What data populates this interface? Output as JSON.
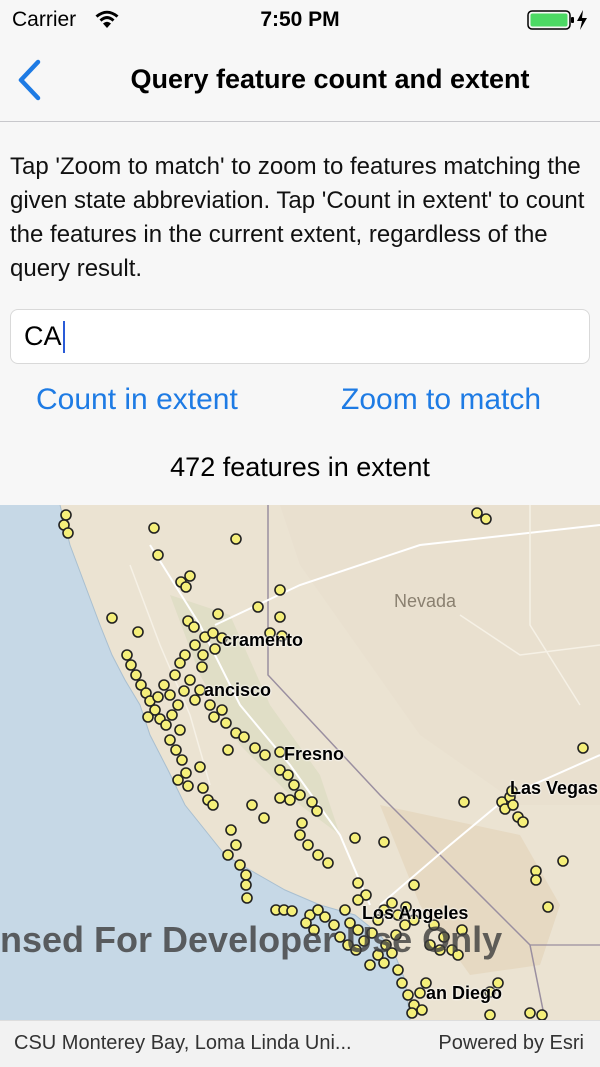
{
  "status": {
    "carrier": "Carrier",
    "time": "7:50 PM"
  },
  "nav": {
    "title": "Query feature count and extent"
  },
  "instructions": "Tap 'Zoom to match' to zoom to features matching the given state abbreviation. Tap 'Count in extent' to count the features in the current extent, regardless of the query result.",
  "search": {
    "value": "CA"
  },
  "buttons": {
    "count": "Count in extent",
    "zoom": "Zoom to match"
  },
  "result": "472 features in extent",
  "map": {
    "labels": {
      "sacramento": "cramento",
      "san_francisco": "ancisco",
      "fresno": "Fresno",
      "las_vegas": "Las Vegas",
      "los_angeles": "Los Angeles",
      "san_diego": "an Diego",
      "nevada": "Nevada"
    },
    "watermark": "ensed For Developer Use Only",
    "marker_color": "#f5ef7a",
    "attribution_left": "CSU Monterey Bay, Loma Linda Uni...",
    "attribution_right": "Powered by Esri"
  },
  "colors": {
    "accent": "#1e7be4",
    "battery": "#4cd964"
  }
}
